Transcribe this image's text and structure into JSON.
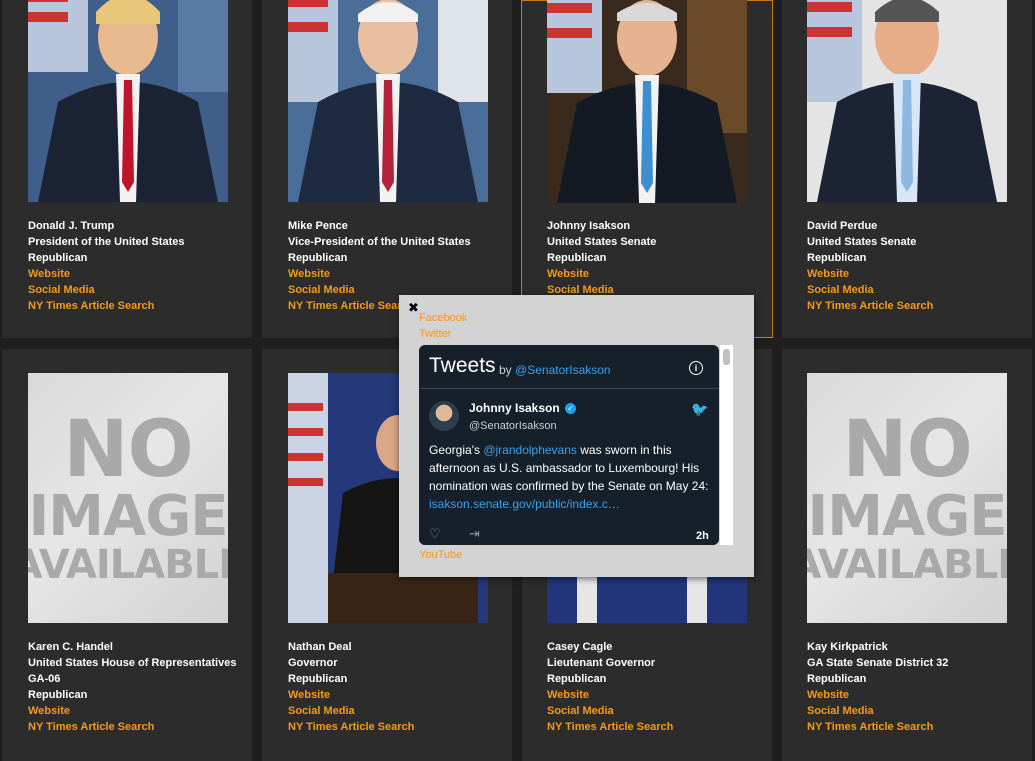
{
  "cards": [
    {
      "name": "Donald J. Trump",
      "role": "President of the United States",
      "party": "Republican",
      "links": [
        "Website",
        "Social Media",
        "NY Times Article Search"
      ]
    },
    {
      "name": "Mike Pence",
      "role": "Vice-President of the United States",
      "party": "Republican",
      "links": [
        "Website",
        "Social Media",
        "NY Times Article Search"
      ]
    },
    {
      "name": "Johnny Isakson",
      "role": "United States Senate",
      "party": "Republican",
      "links": [
        "Website",
        "Social Media"
      ]
    },
    {
      "name": "David Perdue",
      "role": "United States Senate",
      "party": "Republican",
      "links": [
        "Website",
        "Social Media",
        "NY Times Article Search"
      ]
    },
    {
      "name": "Karen C. Handel",
      "role": "United States House of Representatives",
      "district": "GA-06",
      "party": "Republican",
      "links": [
        "Website",
        "NY Times Article Search"
      ]
    },
    {
      "name": "Nathan Deal",
      "role": "Governor",
      "party": "Republican",
      "links": [
        "Website",
        "Social Media",
        "NY Times Article Search"
      ]
    },
    {
      "name": "Casey Cagle",
      "role": "Lieutenant Governor",
      "party": "Republican",
      "links": [
        "Website",
        "Social Media",
        "NY Times Article Search"
      ]
    },
    {
      "name": "Kay Kirkpatrick",
      "role": "GA State Senate District 32",
      "party": "Republican",
      "links": [
        "Website",
        "Social Media",
        "NY Times Article Search"
      ]
    }
  ],
  "no_image": {
    "line1": "NO",
    "line2": "IMAGE",
    "line3": "AVAILABLE"
  },
  "popup": {
    "close": "✖",
    "facebook": "Facebook",
    "twitter": "Twitter",
    "youtube": "YouTube",
    "timeline": {
      "title": "Tweets",
      "by": "by",
      "by_handle": "@SenatorIsakson",
      "user_name": "Johnny Isakson",
      "user_handle": "@SenatorIsakson",
      "text_1": "Georgia's ",
      "mention": "@jrandolphevans",
      "text_2": " was sworn in this afternoon as U.S. ambassador to Luxembourg! His nomination was confirmed by the Senate on May 24: ",
      "link": "isakson.senate.gov/public/index.c…",
      "time": "2h"
    }
  },
  "colors": {
    "link": "#f39a1d",
    "card_bg": "#2c2c2c",
    "page_bg": "#1f1f1f",
    "active_border": "#c77a1a"
  }
}
